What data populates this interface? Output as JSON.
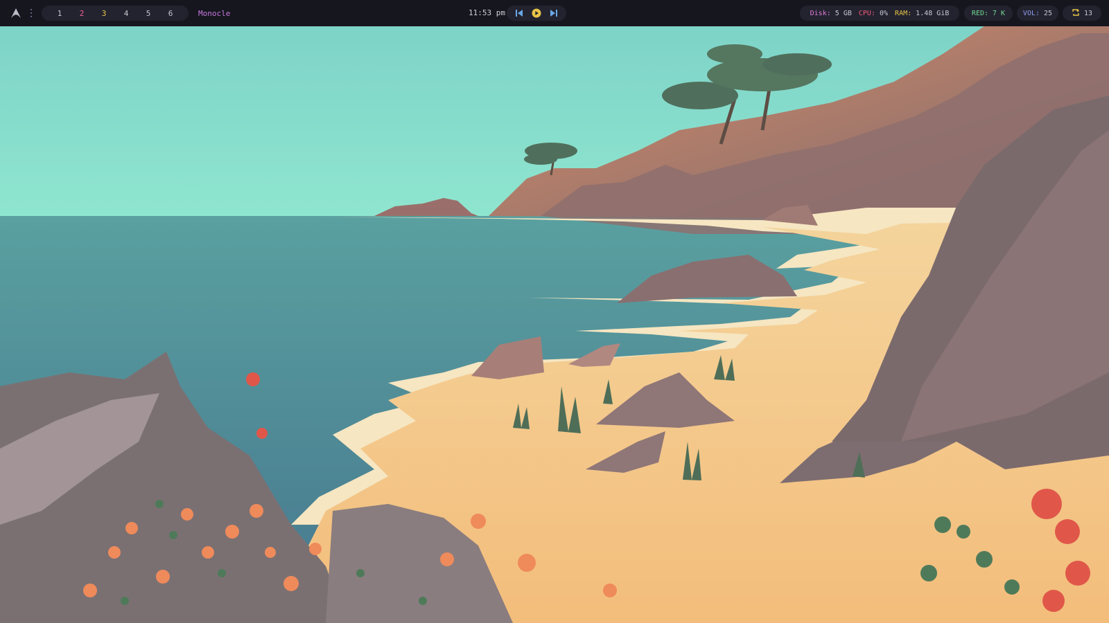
{
  "bar": {
    "workspaces": [
      "1",
      "2",
      "3",
      "4",
      "5",
      "6"
    ],
    "layout": "Monocle",
    "clock": "11:53 pm",
    "stats": {
      "disk_label": "Disk:",
      "disk_value": "5 GB",
      "cpu_label": "CPU:",
      "cpu_value": "0%",
      "ram_label": "RAM:",
      "ram_value": "1.48 GiB"
    },
    "red": {
      "label": "RED:",
      "value": "7 K"
    },
    "vol": {
      "label": "VOL:",
      "value": "25"
    },
    "updates": {
      "value": "13"
    }
  },
  "icons": {
    "logo": "arch-linux-icon",
    "menu": "vertical-dots-icon",
    "prev": "skip-previous-icon",
    "play": "play-icon",
    "next": "skip-next-icon",
    "updates": "refresh-icon"
  },
  "colors": {
    "bar_bg": "#16161f",
    "pill_bg": "#23232f",
    "workspace_2": "#f06292",
    "workspace_3": "#e8c547",
    "layout": "#c678dd",
    "media": "#6aa7e8",
    "play": "#e8c547",
    "sky": "#86dac8",
    "sea": "#4f8d95",
    "sand": "#f2c585"
  }
}
